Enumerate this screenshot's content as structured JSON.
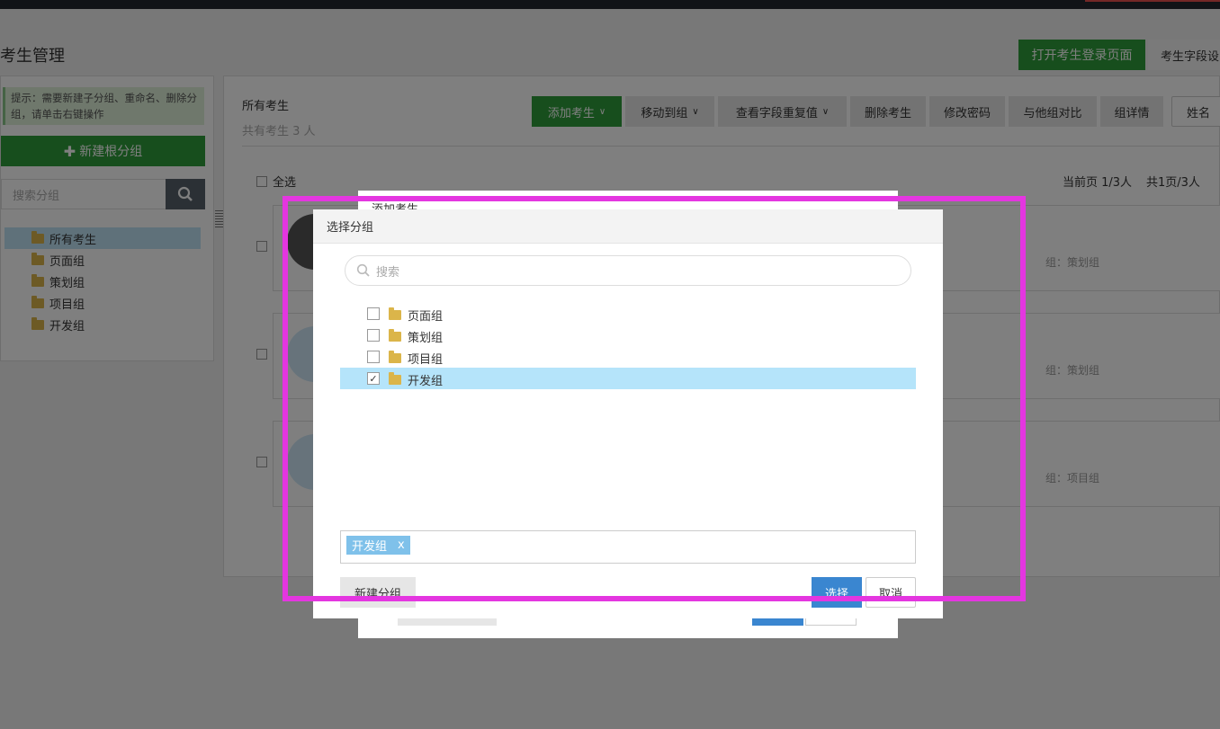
{
  "page": {
    "title": "考生管理"
  },
  "header": {
    "open_login_button": "打开考生登录页面",
    "field_settings_button": "考生字段设"
  },
  "sidebar": {
    "hint": "提示：需要新建子分组、重命名、删除分组，请单击右键操作",
    "new_root_group_button": "新建根分组",
    "search_placeholder": "搜索分组",
    "items": [
      {
        "label": "所有考生",
        "selected": true
      },
      {
        "label": "页面组"
      },
      {
        "label": "策划组"
      },
      {
        "label": "项目组"
      },
      {
        "label": "开发组"
      }
    ]
  },
  "main": {
    "heading": "所有考生",
    "count_text": "共有考生 3 人",
    "toolbar": {
      "add": "添加考生",
      "move": "移动到组",
      "check_dup": "查看字段重复值",
      "delete": "删除考生",
      "change_pwd": "修改密码",
      "compare": "与他组对比",
      "group_detail": "组详情",
      "name_field": "姓名"
    },
    "select_all": "全选",
    "pagination": {
      "current": "当前页 1/3人",
      "total": "共1页/3人"
    },
    "rows": [
      {
        "group": "组：策划组"
      },
      {
        "group": "组：策划组"
      },
      {
        "group": "组：项目组"
      }
    ]
  },
  "back_dialog": {
    "title": "添加考生"
  },
  "dialog": {
    "title": "选择分组",
    "search_placeholder": "搜索",
    "items": [
      {
        "label": "页面组",
        "checked": false
      },
      {
        "label": "策划组",
        "checked": false
      },
      {
        "label": "项目组",
        "checked": false
      },
      {
        "label": "开发组",
        "checked": true
      }
    ],
    "selected_tags": [
      {
        "label": "开发组",
        "remove": "x"
      }
    ],
    "new_group_button": "新建分组",
    "select_button": "选择",
    "cancel_button": "取消"
  },
  "colors": {
    "accent_green": "#2e9d3a",
    "select_blue": "#3a86d0",
    "highlight": "#e436e0"
  }
}
